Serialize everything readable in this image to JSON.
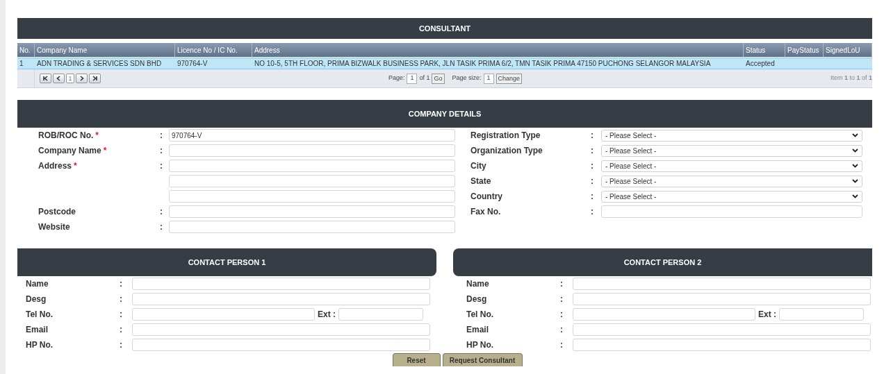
{
  "consultant": {
    "title": "CONSULTANT",
    "columns": [
      "No.",
      "Company Name",
      "Licence No / IC No.",
      "Address",
      "Status",
      "PayStatus",
      "SignedLoU"
    ],
    "rows": [
      {
        "selected": true,
        "cells": [
          "1",
          "ADN TRADING & SERVICES SDN BHD",
          "970764-V",
          "NO 10-5, 5TH FLOOR, PRIMA BIZWALK BUSINESS PARK, JLN TASIK PRIMA 6/2, TMN TASIK PRIMA 47150 PUCHONG SELANGOR MALAYSIA",
          "Accepted",
          "",
          ""
        ]
      }
    ],
    "pager": {
      "current": "1",
      "page_label": "Page:",
      "page_value": "1",
      "page_of": "of 1",
      "go": "Go",
      "size_label": "Page size:",
      "size_value": "1",
      "change": "Change",
      "summary": "Item **1** to **1** of **1**"
    }
  },
  "company_details": {
    "title": "COMPANY DETAILS",
    "left": [
      {
        "label": "ROB/ROC No.",
        "required_mark": "*",
        "colon": ":",
        "kind": "text",
        "value": "970764-V"
      },
      {
        "label": "Company Name",
        "required_mark": "*",
        "colon": ":",
        "kind": "text"
      },
      {
        "label": "Address",
        "required_mark": "*",
        "colon": ":",
        "kind": "text"
      },
      {
        "kind": "text"
      },
      {
        "kind": "text"
      },
      {
        "label": "Postcode",
        "colon": ":",
        "kind": "text"
      },
      {
        "label": "Website",
        "colon": ":",
        "kind": "text"
      }
    ],
    "right": [
      {
        "label": "Registration Type",
        "colon": ":",
        "kind": "select",
        "value": "- Please Select -"
      },
      {
        "label": "Organization Type",
        "colon": ":",
        "kind": "select",
        "value": "- Please Select -"
      },
      {
        "label": "City",
        "colon": ":",
        "kind": "select",
        "value": "- Please Select -"
      },
      {
        "label": "State",
        "colon": ":",
        "kind": "select",
        "value": "- Please Select -"
      },
      {
        "label": "Country",
        "colon": ":",
        "kind": "select",
        "value": "- Please Select -"
      },
      {
        "label": "Fax No.",
        "colon": ":",
        "kind": "text"
      }
    ]
  },
  "contacts": [
    {
      "title": "CONTACT PERSON 1",
      "fields": [
        {
          "label": "Name",
          "colon": ":",
          "kind": "text"
        },
        {
          "label": "Desg",
          "colon": ":",
          "kind": "text"
        },
        {
          "label": "Tel No.",
          "colon": ":",
          "kind": "phone",
          "ext_label": "Ext :"
        },
        {
          "label": "Email",
          "colon": ":",
          "kind": "text"
        },
        {
          "label": "HP No.",
          "colon": ":",
          "kind": "text"
        }
      ]
    },
    {
      "title": "CONTACT PERSON 2",
      "fields": [
        {
          "label": "Name",
          "colon": ":",
          "kind": "text"
        },
        {
          "label": "Desg",
          "colon": ":",
          "kind": "text"
        },
        {
          "label": "Tel No.",
          "colon": ":",
          "kind": "phone",
          "ext_label": "Ext :"
        },
        {
          "label": "Email",
          "colon": ":",
          "kind": "text"
        },
        {
          "label": "HP No.",
          "colon": ":",
          "kind": "text"
        }
      ]
    }
  ],
  "buttons": [
    "Reset",
    "Request Consultant"
  ]
}
